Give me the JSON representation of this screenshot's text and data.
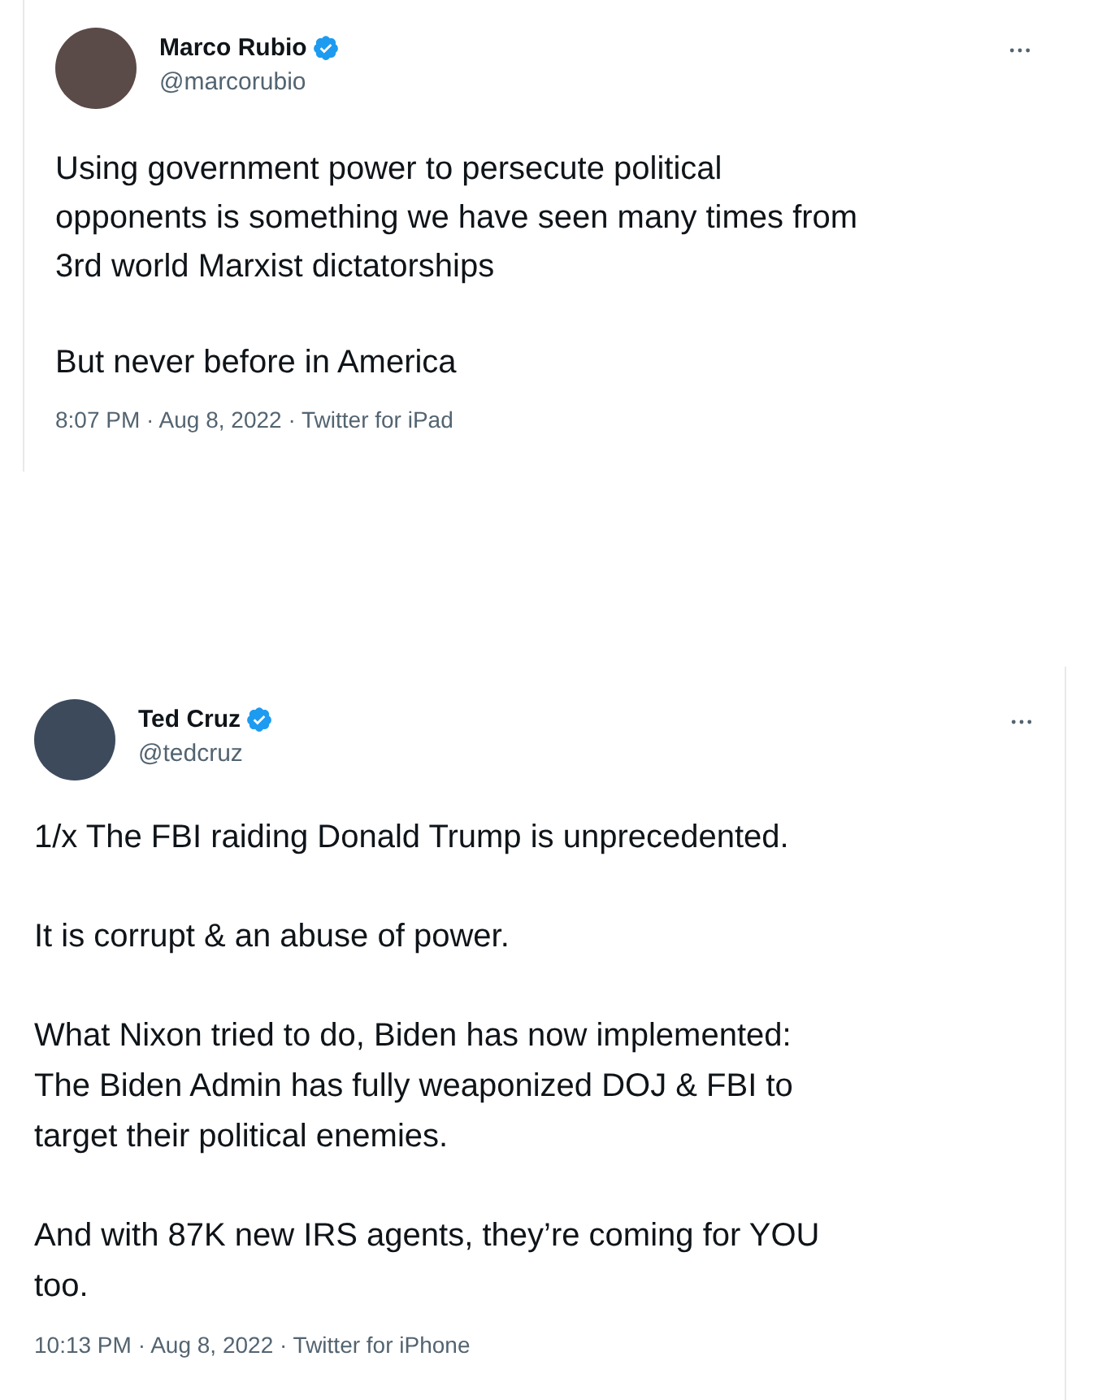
{
  "tweets": [
    {
      "author": {
        "name": "Marco Rubio",
        "handle": "@marcorubio",
        "verified": true
      },
      "paragraphs": [
        "Using government power to persecute political\nopponents is something we have seen many times from\n3rd world Marxist dictatorships",
        "But never before in America"
      ],
      "meta": "8:07 PM · Aug 8, 2022 · Twitter for iPad"
    },
    {
      "author": {
        "name": "Ted Cruz",
        "handle": "@tedcruz",
        "verified": true
      },
      "paragraphs": [
        "1/x The FBI raiding Donald Trump is unprecedented.",
        "It is corrupt & an abuse of power.",
        "What Nixon tried to do, Biden has now implemented:\nThe Biden Admin has fully weaponized DOJ & FBI to\ntarget their political enemies.",
        "And with 87K new IRS agents, they’re coming for YOU\ntoo."
      ],
      "meta": "10:13 PM · Aug 8, 2022 · Twitter for iPhone"
    }
  ]
}
